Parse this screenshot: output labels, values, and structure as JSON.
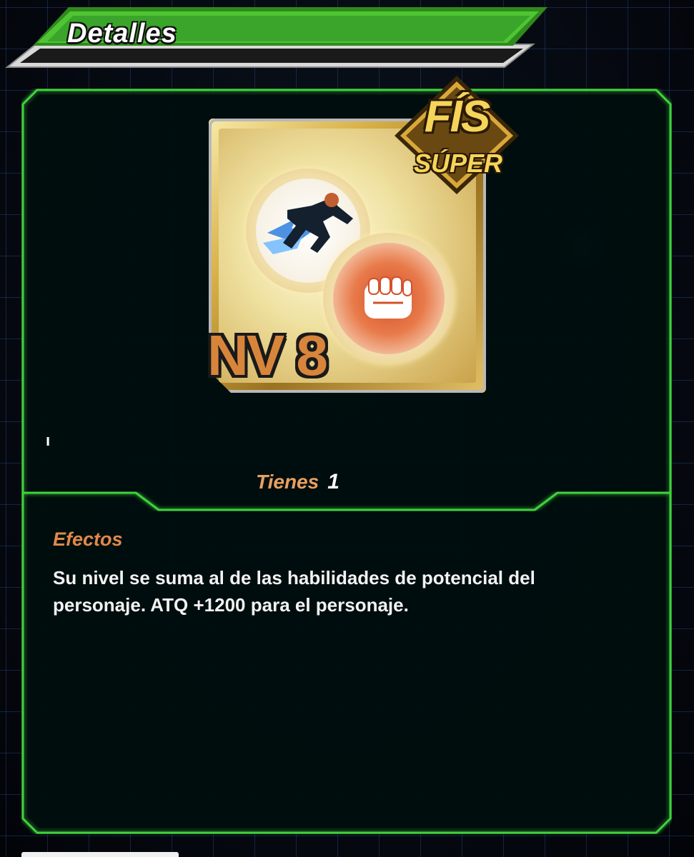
{
  "header": {
    "title": "Detalles"
  },
  "item": {
    "type_label": "FÍS",
    "rarity_label": "SÚPER",
    "level_label": "NV 8",
    "icons": [
      "running-figure-icon",
      "fist-icon"
    ]
  },
  "marker": {
    "text": "ı"
  },
  "owned": {
    "label": "Tienes",
    "count": "1"
  },
  "effects": {
    "title": "Efectos",
    "text": "Su nivel se suma al de las habilidades de potencial del personaje. ATQ +1200 para el personaje."
  },
  "colors": {
    "accent_green": "#3fd23a",
    "gold": "#f6d45a",
    "orange": "#e0894a",
    "panel_bg": "#0a0f18"
  }
}
